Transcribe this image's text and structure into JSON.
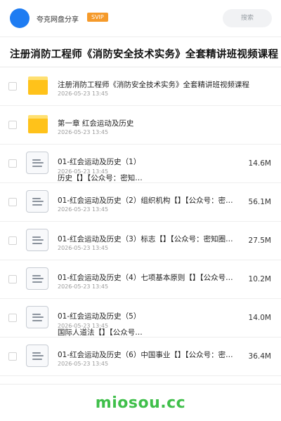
{
  "header": {
    "brand": "夸克网盘分享",
    "badge": "SVIP",
    "search_placeholder": "搜索"
  },
  "page_title": "注册消防工程师《消防安全技术实务》全套精讲班视频课程",
  "items": [
    {
      "type": "folder",
      "name": "注册消防工程师《消防安全技术实务》全套精讲班视频课程",
      "date": "2026-05-23 13:45",
      "size": ""
    },
    {
      "type": "folder",
      "name": "第一章  红会运动及历史",
      "date": "2026-05-23 13:45",
      "size": ""
    },
    {
      "type": "file",
      "name": "01-红会运动及历史（1）",
      "name_line2": "历史【】【公众号：密知…",
      "date": "2026-05-23 13:45",
      "size": "14.6M"
    },
    {
      "type": "file",
      "name": "01-红会运动及历史（2）组织机构【】【公众号：密…",
      "date": "2026-05-23 13:45",
      "size": "56.1M"
    },
    {
      "type": "file",
      "name": "01-红会运动及历史（3）标志【】【公众号：密知圈…",
      "date": "2026-05-23 13:45",
      "size": "27.5M"
    },
    {
      "type": "file",
      "name": "01-红会运动及历史（4）七项基本原则【】【公众号…",
      "date": "2026-05-23 13:45",
      "size": "10.2M"
    },
    {
      "type": "file",
      "name": "01-红会运动及历史（5）",
      "name_line2": "国际人道法【】【公众号…",
      "date": "2026-05-23 13:45",
      "size": "14.0M"
    },
    {
      "type": "file",
      "name": "01-红会运动及历史（6）中国事业【】【公众号：密…",
      "date": "2026-05-23 13:45",
      "size": "36.4M"
    }
  ],
  "watermark": "miosou.cc"
}
